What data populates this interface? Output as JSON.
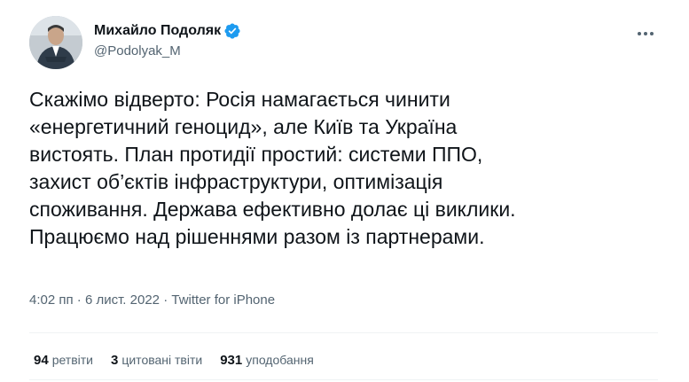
{
  "author": {
    "name": "Михайло Подоляк",
    "handle": "@Podolyak_M",
    "verified_color": "#1d9bf0"
  },
  "tweet": {
    "lines": [
      "Скажімо відверто: Росія намагається чинити",
      "«енергетичний геноцид», але Київ та Україна",
      "вистоять. План протидії простий: системи ППО,",
      "захист об’єктів інфраструктури, оптимізація",
      "споживання. Держава ефективно долає ці виклики.",
      "Працюємо над рішеннями разом із партнерами."
    ]
  },
  "meta": {
    "time": "4:02 пп",
    "separator": "·",
    "date": "6 лист. 2022",
    "source": "Twitter for iPhone"
  },
  "stats": {
    "retweets_count": "94",
    "retweets_label": "ретвіти",
    "quotes_count": "3",
    "quotes_label": "цитовані твіти",
    "likes_count": "931",
    "likes_label": "уподобання"
  },
  "icons": {
    "more": "more-icon",
    "verified": "verified-badge-icon"
  }
}
